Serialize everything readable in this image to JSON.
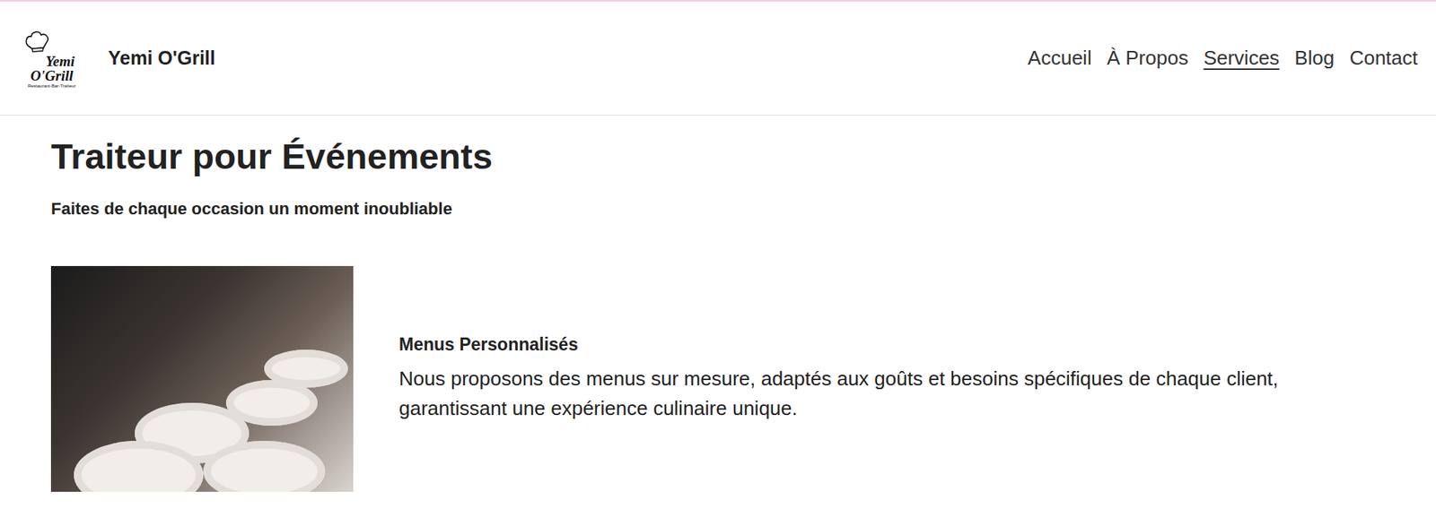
{
  "header": {
    "logo": {
      "line1": "Yemi",
      "line2": "O'Grill",
      "tagline": "Restaurant-Bar-Traiteur"
    },
    "brand": "Yemi O'Grill"
  },
  "nav": [
    {
      "label": "Accueil",
      "selected": false
    },
    {
      "label": "À Propos",
      "selected": false
    },
    {
      "label": "Services",
      "selected": true
    },
    {
      "label": "Blog",
      "selected": false
    },
    {
      "label": "Contact",
      "selected": false
    }
  ],
  "page": {
    "title": "Traiteur pour Événements",
    "subtitle": "Faites de chaque occasion un moment inoubliable"
  },
  "services": [
    {
      "heading": "Menus Personnalisés",
      "text": "Nous proposons des menus sur mesure, adaptés aux goûts et besoins spécifiques de chaque client, garantissant une expérience culinaire unique."
    }
  ]
}
